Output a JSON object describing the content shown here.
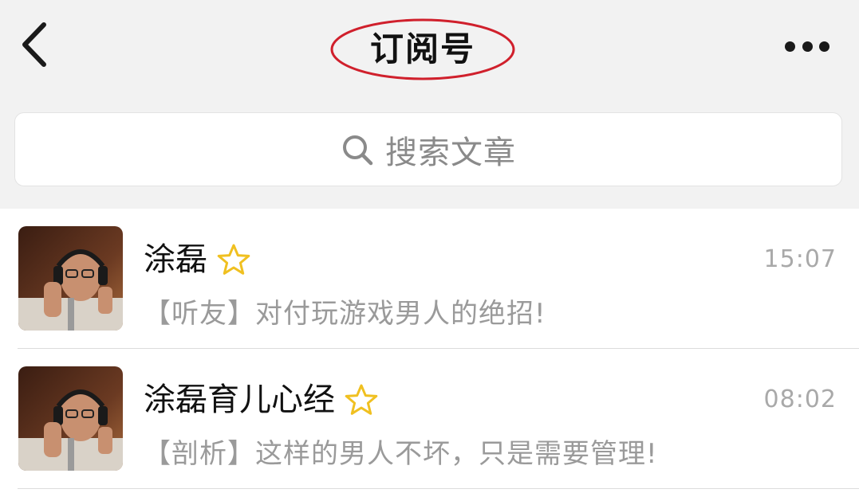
{
  "header": {
    "back_icon": "chevron-left-icon",
    "title": "订阅号",
    "more_icon": "more-dots-icon",
    "title_highlight_color": "#d0202c"
  },
  "search": {
    "icon": "search-icon",
    "placeholder": "搜索文章"
  },
  "list": {
    "items": [
      {
        "name": "涂磊",
        "starred": true,
        "time": "15:07",
        "preview": "【听友】对付玩游戏男人的绝招!"
      },
      {
        "name": "涂磊育儿心经",
        "starred": true,
        "time": "08:02",
        "preview": "【剖析】这样的男人不坏，只是需要管理!"
      }
    ]
  },
  "colors": {
    "background": "#f2f2f2",
    "star": "#f0c020",
    "secondary_text": "#9a9a9a"
  }
}
